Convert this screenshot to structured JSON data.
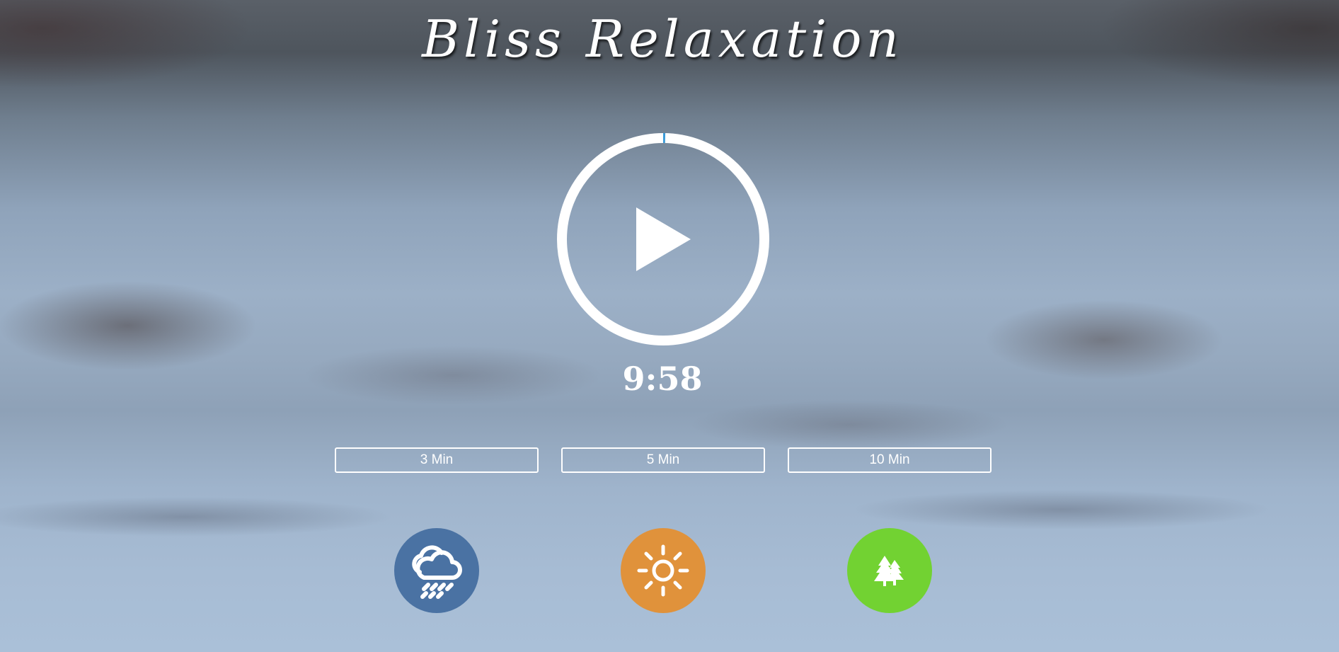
{
  "app": {
    "title": "Bliss Relaxation"
  },
  "player": {
    "state": "paused",
    "icon": "play-icon",
    "progress_fraction": 0.0033,
    "timer_text": "9:58",
    "ring_color": "#ffffff",
    "progress_color": "#3a9bd9"
  },
  "durations": [
    {
      "label": "3 Min"
    },
    {
      "label": "5 Min"
    },
    {
      "label": "10 Min"
    }
  ],
  "sounds": [
    {
      "name": "rain",
      "icon": "cloud-rain-icon",
      "color": "#4a72a3"
    },
    {
      "name": "sun",
      "icon": "sun-icon",
      "color": "#e0923b"
    },
    {
      "name": "forest",
      "icon": "pine-tree-icon",
      "color": "#72d232"
    }
  ]
}
